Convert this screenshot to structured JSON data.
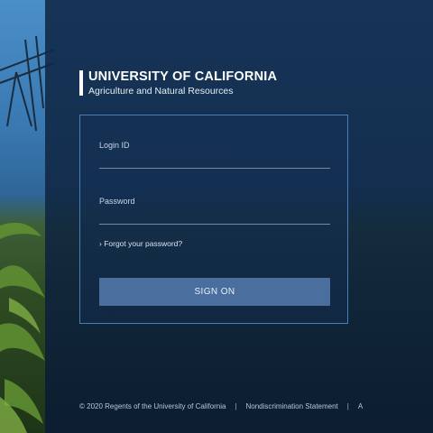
{
  "brand": {
    "title": "UNIVERSITY OF CALIFORNIA",
    "subtitle": "Agriculture and Natural Resources"
  },
  "login": {
    "id_label": "Login ID",
    "id_value": "",
    "password_label": "Password",
    "password_value": "",
    "forgot_label": "› Forgot your password?",
    "submit_label": "SIGN ON"
  },
  "footer": {
    "copyright": "© 2020 Regents of the University of California",
    "separator": "|",
    "nondiscrimination": "Nondiscrimination Statement",
    "accessibility": "A"
  },
  "colors": {
    "overlay": "#0e2440",
    "box_border": "#548ccd",
    "button": "#4a6f9e",
    "text": "#ffffff"
  }
}
